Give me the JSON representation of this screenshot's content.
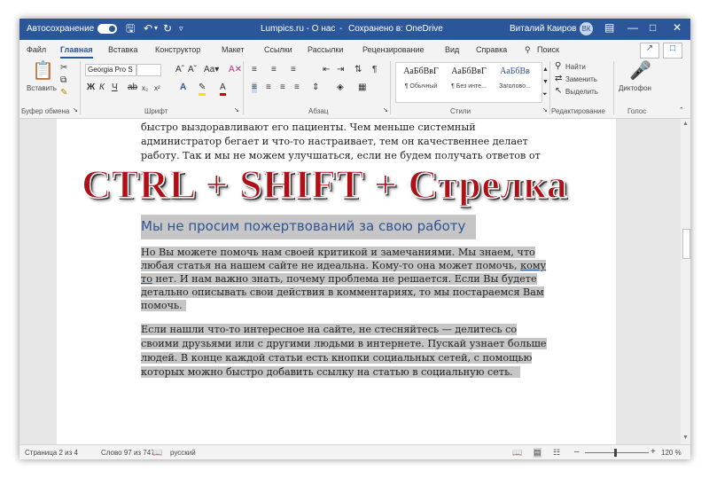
{
  "titlebar": {
    "autosave_label": "Автосохранение",
    "doc_title": "Lumpics.ru - О нас",
    "save_status": "Сохранено в: OneDrive",
    "user_name": "Виталий Каиров",
    "avatar_initials": "ВК"
  },
  "tabs": [
    "Файл",
    "Главная",
    "Вставка",
    "Конструктор",
    "Макет",
    "Ссылки",
    "Рассылки",
    "Рецензирование",
    "Вид",
    "Справка"
  ],
  "search_label": "Поиск",
  "ribbon": {
    "paste_label": "Вставить",
    "clipboard_label": "Буфер обмена",
    "font_name": "Georgia Pro S",
    "font_size": "",
    "font_label": "Шрифт",
    "bold": "Ж",
    "italic": "К",
    "underline": "Ч",
    "paragraph_label": "Абзац",
    "styles": [
      {
        "sample": "АаБбВвГ",
        "name": "¶ Обычный"
      },
      {
        "sample": "АаБбВвГ",
        "name": "¶ Без инте..."
      },
      {
        "sample": "АаБбВв",
        "name": "Заголово..."
      }
    ],
    "styles_label": "Стили",
    "find_label": "Найти",
    "replace_label": "Заменить",
    "select_label": "Выделить",
    "editing_label": "Редактирование",
    "dictate_label": "Диктофон",
    "voice_label": "Голос"
  },
  "document": {
    "top_lines": [
      "быстро выздоравливают его пациенты. Чем меньше системный",
      "администратор бегает и что-то настраивает, тем он качественнее делает",
      "работу. Так и мы не можем улучшаться, если не будем получать ответов от"
    ],
    "overlay_text": "CTRL + SHIFT + Стрелка",
    "heading": "Мы не просим пожертвований за свою работу",
    "para1": {
      "line1": "Но Вы можете помочь нам своей критикой и замечаниями. Мы знаем, что",
      "line2_pre": "любая статья на нашем сайте не идеальна. Кому-то она может помочь, ",
      "line2_link": "кому",
      "line3_link": "то",
      "line3_post": " нет. И нам важно знать, почему проблема не решается. Если Вы будете",
      "line4": "детально описывать свои действия в комментариях, то мы постараемся Вам",
      "line5": "помочь."
    },
    "para2_lines": [
      "Если нашли что-то интересное на сайте, не стесняйтесь — делитесь со",
      "своими друзьями или с другими людьми в интернете. Пускай узнает больше",
      "людей. В конце каждой статьи есть кнопки социальных сетей, с помощью",
      "которых можно быстро добавить ссылку на статью в социальную сеть."
    ]
  },
  "statusbar": {
    "page": "Страница 2 из 4",
    "words": "Слово 97 из 747",
    "language": "русский",
    "zoom": "120 %"
  }
}
